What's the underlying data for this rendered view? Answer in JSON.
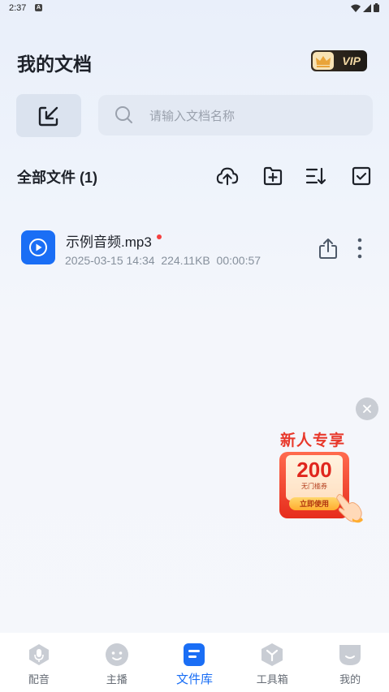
{
  "status_bar": {
    "time": "2:37",
    "notification_letter": "A"
  },
  "header": {
    "title": "我的文档",
    "vip_label": "VIP"
  },
  "search": {
    "placeholder": "请输入文档名称"
  },
  "section": {
    "title": "全部文件 (1)"
  },
  "toolbar": {
    "icons": [
      "cloud-upload-icon",
      "new-folder-icon",
      "sort-icon",
      "select-all-icon"
    ]
  },
  "files": [
    {
      "name": "示例音频.mp3",
      "date": "2025-03-15 14:34",
      "size": "224.11KB",
      "duration": "00:00:57",
      "meta": "2025-03-15 14:34  224.11KB  00:00:57",
      "unread": true
    }
  ],
  "promo": {
    "title": "新人专享",
    "amount": "200",
    "subtitle": "无门槛券",
    "button": "立即使用"
  },
  "tabs": [
    {
      "label": "配音",
      "icon": "dubbing-icon",
      "active": false
    },
    {
      "label": "主播",
      "icon": "anchor-icon",
      "active": false
    },
    {
      "label": "文件库",
      "icon": "file-library-icon",
      "active": true
    },
    {
      "label": "工具箱",
      "icon": "toolbox-icon",
      "active": false
    },
    {
      "label": "我的",
      "icon": "profile-icon",
      "active": false
    }
  ],
  "colors": {
    "accent": "#1a6ef5",
    "unread_dot": "#f53f3f",
    "promo_red": "#e8382b",
    "vip_gold": "#f3d9a4"
  }
}
